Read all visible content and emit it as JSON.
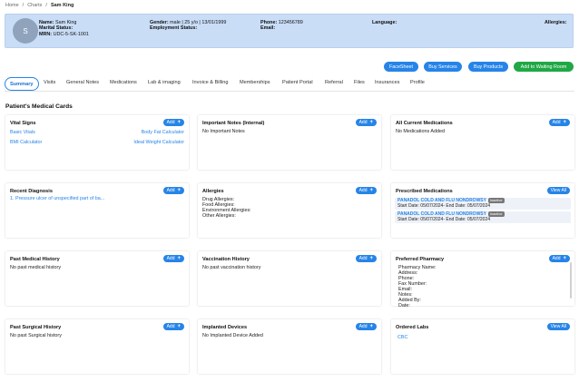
{
  "breadcrumb": {
    "items": [
      "Home",
      "Charts",
      "Sam King"
    ]
  },
  "patient": {
    "avatar_initial": "S",
    "name_label": "Name:",
    "name": "Sam King",
    "marital_label": "Marital Status:",
    "marital": "",
    "mrn_label": "MRN:",
    "mrn": "UDC-5-SK-1001",
    "gender_label": "Gender:",
    "gender": "male | 25 y/o | 13/01/1999",
    "employment_label": "Employment Status:",
    "phone_label": "Phone:",
    "phone": "123456789",
    "email_label": "Email:",
    "language_label": "Language:",
    "allergies_label": "Allergies:"
  },
  "actions": [
    "FaceSheet",
    "Buy Services",
    "Buy Products",
    "Add to Waiting Room"
  ],
  "tabs": [
    "Summary",
    "Visits",
    "General Notes",
    "Medications",
    "Lab & imaging",
    "Invoice & Billing",
    "Memberships",
    "Patient Portal",
    "Referral",
    "Files",
    "Insurances",
    "Profile"
  ],
  "section_title": "Patient's Medical Cards",
  "add_label": "Add",
  "view_all_label": "View All",
  "cards": {
    "vital_signs": {
      "title": "Vital Signs",
      "links": [
        "Basic Vitals",
        "Body Fat Calculator",
        "BMI Calculator",
        "Ideal Weight Calculator"
      ]
    },
    "important_notes": {
      "title": "Important Notes (Internal)",
      "empty": "No Important Notes"
    },
    "current_medications": {
      "title": "All Current Medications",
      "empty": "No Medications Added"
    },
    "recent_diagnosis": {
      "title": "Recent Diagnosis",
      "item": "1. Pressure ulcer of unspecified part of ba..."
    },
    "allergies": {
      "title": "Allergies",
      "lines": [
        "Drug Allergies:",
        "Food Allergies:",
        "Environment Allergies:",
        "Other Allergies:"
      ]
    },
    "prescribed_medications": {
      "title": "Prescribed Medications",
      "items": [
        {
          "name": "PANADOL COLD AND FLU NONDROWSY",
          "badge": "inactive",
          "dates": "Start Date: 05/07/2024- End Date: 05/07/2024"
        },
        {
          "name": "PANADOL COLD AND FLU NONDROWSY",
          "badge": "inactive",
          "dates": "Start Date: 05/07/2024- End Date: 05/07/2024"
        }
      ]
    },
    "past_medical_history": {
      "title": "Past Medical History",
      "empty": "No past medical history"
    },
    "vaccination_history": {
      "title": "Vaccination History",
      "empty": "No past vaccination history"
    },
    "preferred_pharmacy": {
      "title": "Preferred Pharmacy",
      "lines": [
        "Pharmacy Name:",
        "Address:",
        "Phone:",
        "Fax Number:",
        "Email:",
        "Notes:",
        "Added By:",
        "Date:"
      ]
    },
    "past_surgical_history": {
      "title": "Past Surgical History",
      "empty": "No past Surgical history"
    },
    "implanted_devices": {
      "title": "Implanted Devices",
      "empty": "No Implanted Device Added"
    },
    "ordered_labs": {
      "title": "Ordered Labs",
      "item": "CBC"
    }
  },
  "colors": {
    "accent": "#2684e8",
    "green": "#1fa845",
    "header_bg": "#c9ddf7"
  }
}
